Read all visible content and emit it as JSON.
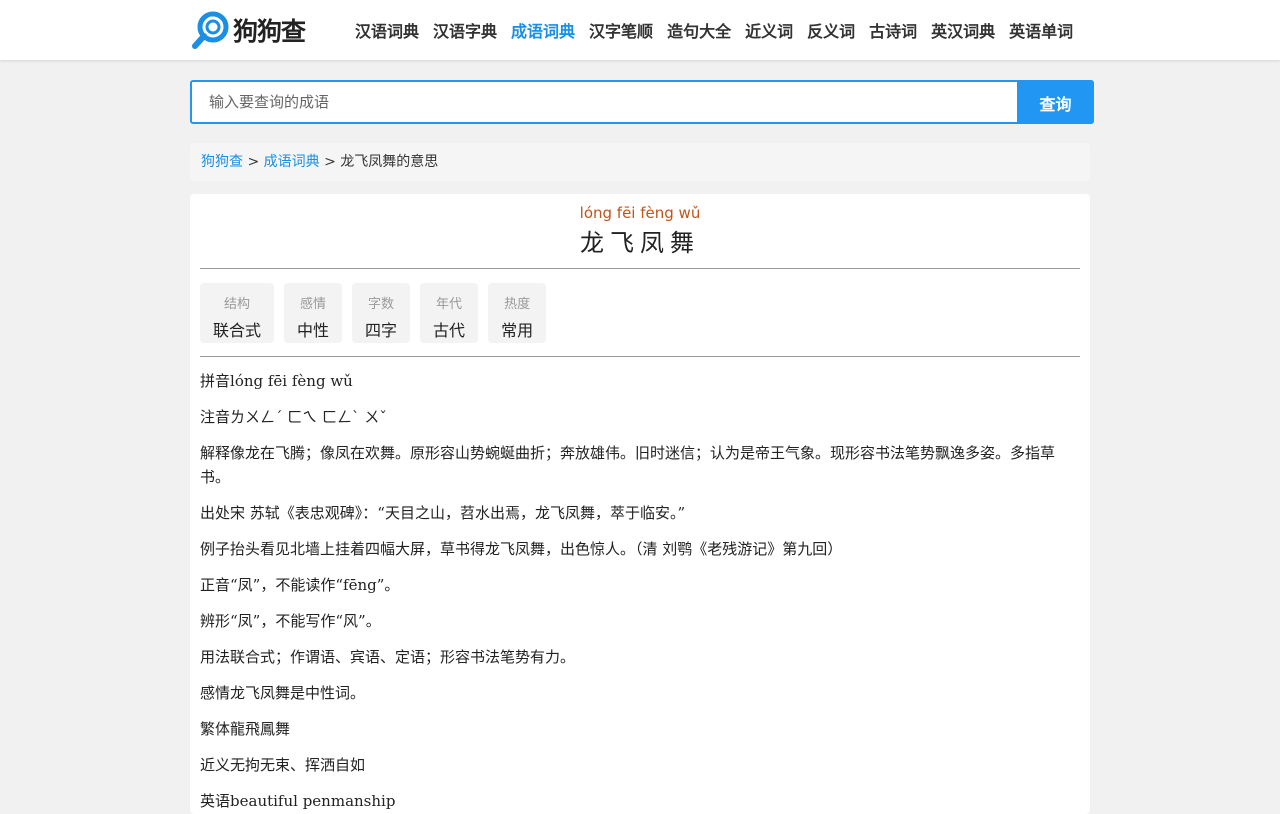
{
  "logo": {
    "text": "狗狗查"
  },
  "nav": [
    {
      "label": "汉语词典",
      "active": false
    },
    {
      "label": "汉语字典",
      "active": false
    },
    {
      "label": "成语词典",
      "active": true
    },
    {
      "label": "汉字笔顺",
      "active": false
    },
    {
      "label": "造句大全",
      "active": false
    },
    {
      "label": "近义词",
      "active": false
    },
    {
      "label": "反义词",
      "active": false
    },
    {
      "label": "古诗词",
      "active": false
    },
    {
      "label": "英汉词典",
      "active": false
    },
    {
      "label": "英语单词",
      "active": false
    }
  ],
  "search": {
    "placeholder": "输入要查询的成语",
    "value": "",
    "button_label": "查询"
  },
  "breadcrumb": {
    "home": "狗狗查",
    "sep": ">",
    "section": "成语词典",
    "current": "龙飞凤舞的意思"
  },
  "idiom": {
    "pinyin": "lóng fēi fèng wǔ",
    "word": "龙飞凤舞"
  },
  "tags": [
    {
      "label": "结构",
      "value": "联合式"
    },
    {
      "label": "感情",
      "value": "中性"
    },
    {
      "label": "字数",
      "value": "四字"
    },
    {
      "label": "年代",
      "value": "古代"
    },
    {
      "label": "热度",
      "value": "常用"
    }
  ],
  "details": [
    {
      "key": "拼音",
      "value": "lóng fēi fèng wǔ"
    },
    {
      "key": "注音",
      "value": "ㄌㄨㄥˊ ㄈㄟ ㄈㄥˋ ㄨˇ"
    },
    {
      "key": "解释",
      "value": "像龙在飞腾；像凤在欢舞。原形容山势蜿蜒曲折；奔放雄伟。旧时迷信；认为是帝王气象。现形容书法笔势飘逸多姿。多指草书。"
    },
    {
      "key": "出处",
      "value": "宋 苏轼《表忠观碑》：“天目之山，苕水出焉，龙飞凤舞，萃于临安。”"
    },
    {
      "key": "例子",
      "value": "抬头看见北墙上挂着四幅大屏，草书得龙飞凤舞，出色惊人。（清 刘鹗《老残游记》第九回）"
    },
    {
      "key": "正音",
      "value": "“凤”，不能读作“fēng”。"
    },
    {
      "key": "辨形",
      "value": "“凤”，不能写作“风”。"
    },
    {
      "key": "用法",
      "value": "联合式；作谓语、宾语、定语；形容书法笔势有力。"
    },
    {
      "key": "感情",
      "value": "龙飞凤舞是中性词。"
    },
    {
      "key": "繁体",
      "value": "龍飛鳳舞"
    },
    {
      "key": "近义",
      "value": "无拘无束、挥洒自如"
    },
    {
      "key": "英语",
      "value": "beautiful penmanship"
    }
  ],
  "colors": {
    "accent": "#2196f3",
    "link": "#1a8fe3",
    "pinyin": "#c0541a"
  }
}
